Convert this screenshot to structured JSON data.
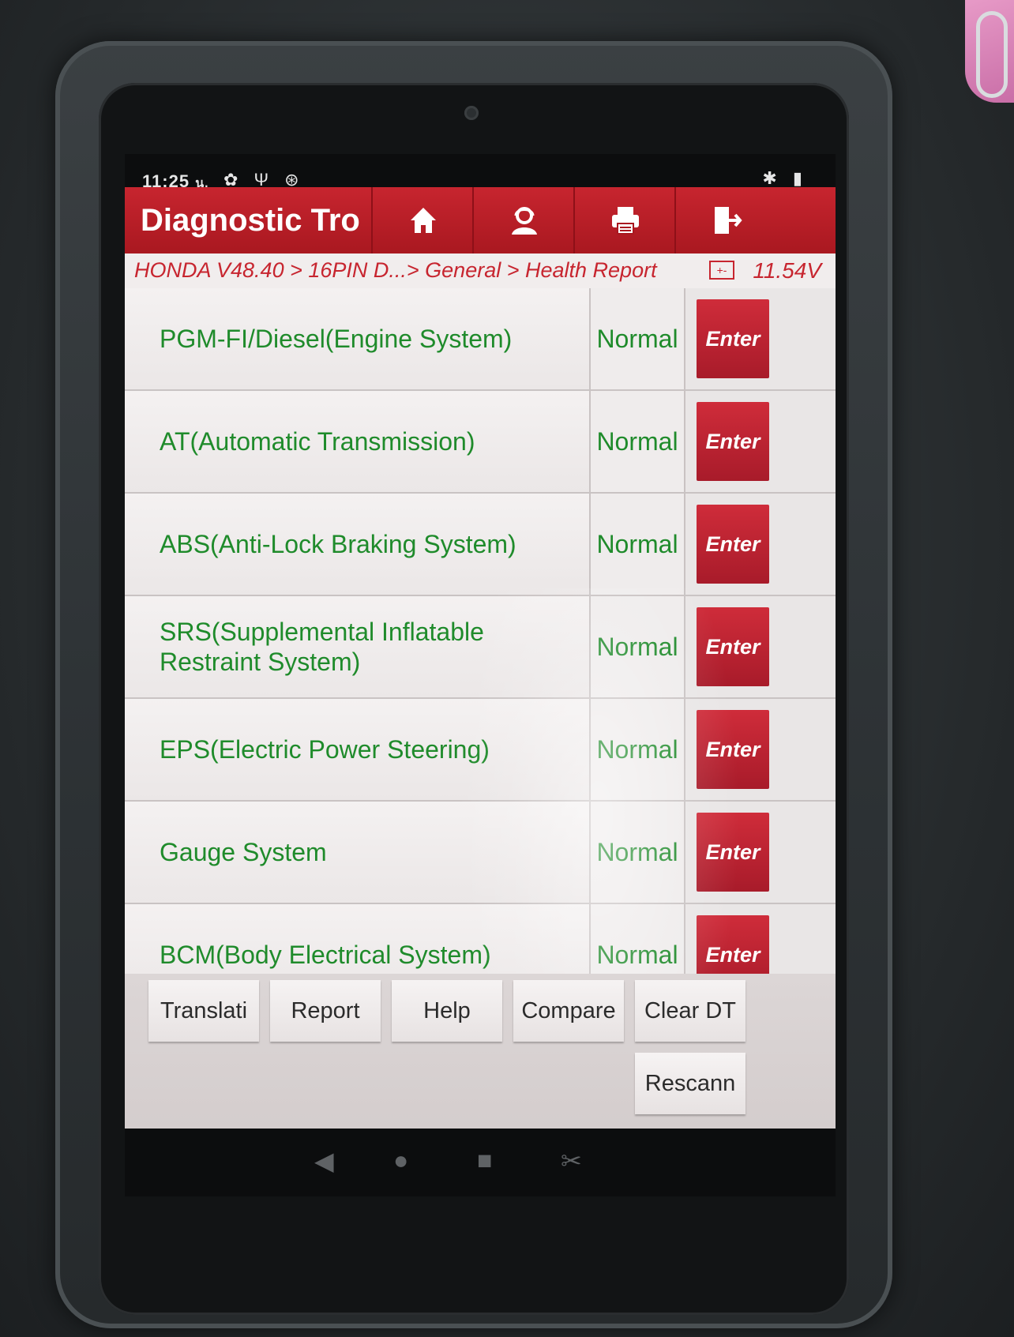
{
  "status": {
    "time": "11:25",
    "time_suffix": "น.",
    "icons": [
      "gear-icon",
      "usb-icon",
      "accessibility-icon"
    ],
    "right_icons": [
      "bluetooth-icon",
      "battery-icon"
    ],
    "gear": "✿",
    "usb": "Ψ",
    "accessibility": "⊛",
    "bluetooth": "✱",
    "battery": "▮"
  },
  "appbar": {
    "title": "Diagnostic Tro",
    "tools": [
      {
        "name": "home-icon",
        "glyph": "⌂"
      },
      {
        "name": "user-support-icon",
        "glyph": "☺"
      },
      {
        "name": "print-icon",
        "glyph": "⎙"
      },
      {
        "name": "exit-icon",
        "glyph": "⇥"
      }
    ],
    "color": "#c7252f"
  },
  "breadcrumb": {
    "path": "HONDA V48.40 > 16PIN D...> General > Health Report",
    "battery_glyph": "+-",
    "voltage": "11.54V"
  },
  "systems": [
    {
      "name": "PGM-FI/Diesel(Engine System)",
      "status": "Normal",
      "action": "Enter"
    },
    {
      "name": "AT(Automatic Transmission)",
      "status": "Normal",
      "action": "Enter"
    },
    {
      "name": "ABS(Anti-Lock Braking System)",
      "status": "Normal",
      "action": "Enter"
    },
    {
      "name": "SRS(Supplemental Inflatable Restraint System)",
      "status": "Normal",
      "action": "Enter"
    },
    {
      "name": "EPS(Electric Power Steering)",
      "status": "Normal",
      "action": "Enter"
    },
    {
      "name": "Gauge System",
      "status": "Normal",
      "action": "Enter"
    },
    {
      "name": "BCM(Body Electrical System)",
      "status": "Normal",
      "action": "Enter"
    }
  ],
  "toolbar": {
    "translation": "Translati",
    "report": "Report",
    "help": "Help",
    "compare": "Compare",
    "clear_dtc": "Clear DT",
    "rescan": "Rescann"
  },
  "nav": {
    "back": "◀",
    "home": "●",
    "recents": "■",
    "screenshot": "✂"
  },
  "colors": {
    "accent": "#c7252f",
    "status_ok": "#1f8b2b"
  }
}
